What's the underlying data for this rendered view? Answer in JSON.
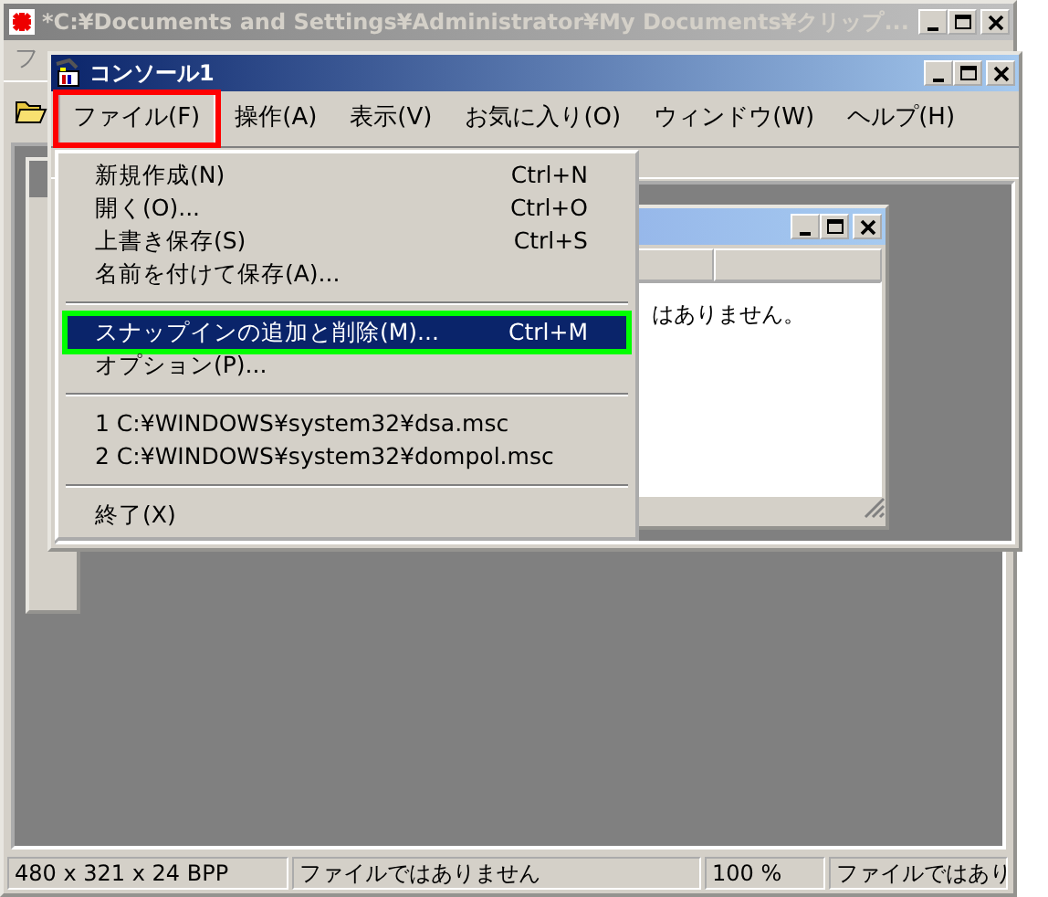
{
  "outer_window": {
    "title": "*C:¥Documents and Settings¥Administrator¥My Documents¥クリップ...",
    "active": false,
    "menu_bar": [
      "フ"
    ],
    "status_bar": [
      "480 x 321 x 24 BPP",
      "ファイルではありません",
      "100 %",
      "ファイルではあり"
    ]
  },
  "console_window": {
    "title": "コンソール1",
    "active": true,
    "menu_bar": [
      {
        "label": "ファイル(F)",
        "selected": true,
        "frame": {
          "color": "#ff0000"
        }
      },
      {
        "label": "操作(A)",
        "selected": false
      },
      {
        "label": "表示(V)",
        "selected": false
      },
      {
        "label": "お気に入り(O)",
        "selected": false
      },
      {
        "label": "ウィンドウ(W)",
        "selected": false
      },
      {
        "label": "ヘルプ(H)",
        "selected": false
      }
    ],
    "file_menu": [
      {
        "kind": "item",
        "label": "新規作成(N)",
        "shortcut": "Ctrl+N",
        "selected": false
      },
      {
        "kind": "item",
        "label": "開く(O)...",
        "shortcut": "Ctrl+O",
        "selected": false
      },
      {
        "kind": "item",
        "label": "上書き保存(S)",
        "shortcut": "Ctrl+S",
        "selected": false
      },
      {
        "kind": "item",
        "label": "名前を付けて保存(A)...",
        "selected": false
      },
      {
        "kind": "separator"
      },
      {
        "kind": "item",
        "label": "スナップインの追加と削除(M)...",
        "shortcut": "Ctrl+M",
        "selected": true,
        "frame": {
          "color": "#00ff00"
        }
      },
      {
        "kind": "item",
        "label": "オプション(P)...",
        "selected": false
      },
      {
        "kind": "separator"
      },
      {
        "kind": "item",
        "label": "1 C:¥WINDOWS¥system32¥dsa.msc",
        "selected": false
      },
      {
        "kind": "item",
        "label": "2 C:¥WINDOWS¥system32¥dompol.msc",
        "selected": false
      },
      {
        "kind": "separator"
      },
      {
        "kind": "item",
        "label": "終了(X)",
        "selected": false
      }
    ],
    "child_window": {
      "active": false,
      "message": "はありません。"
    }
  }
}
